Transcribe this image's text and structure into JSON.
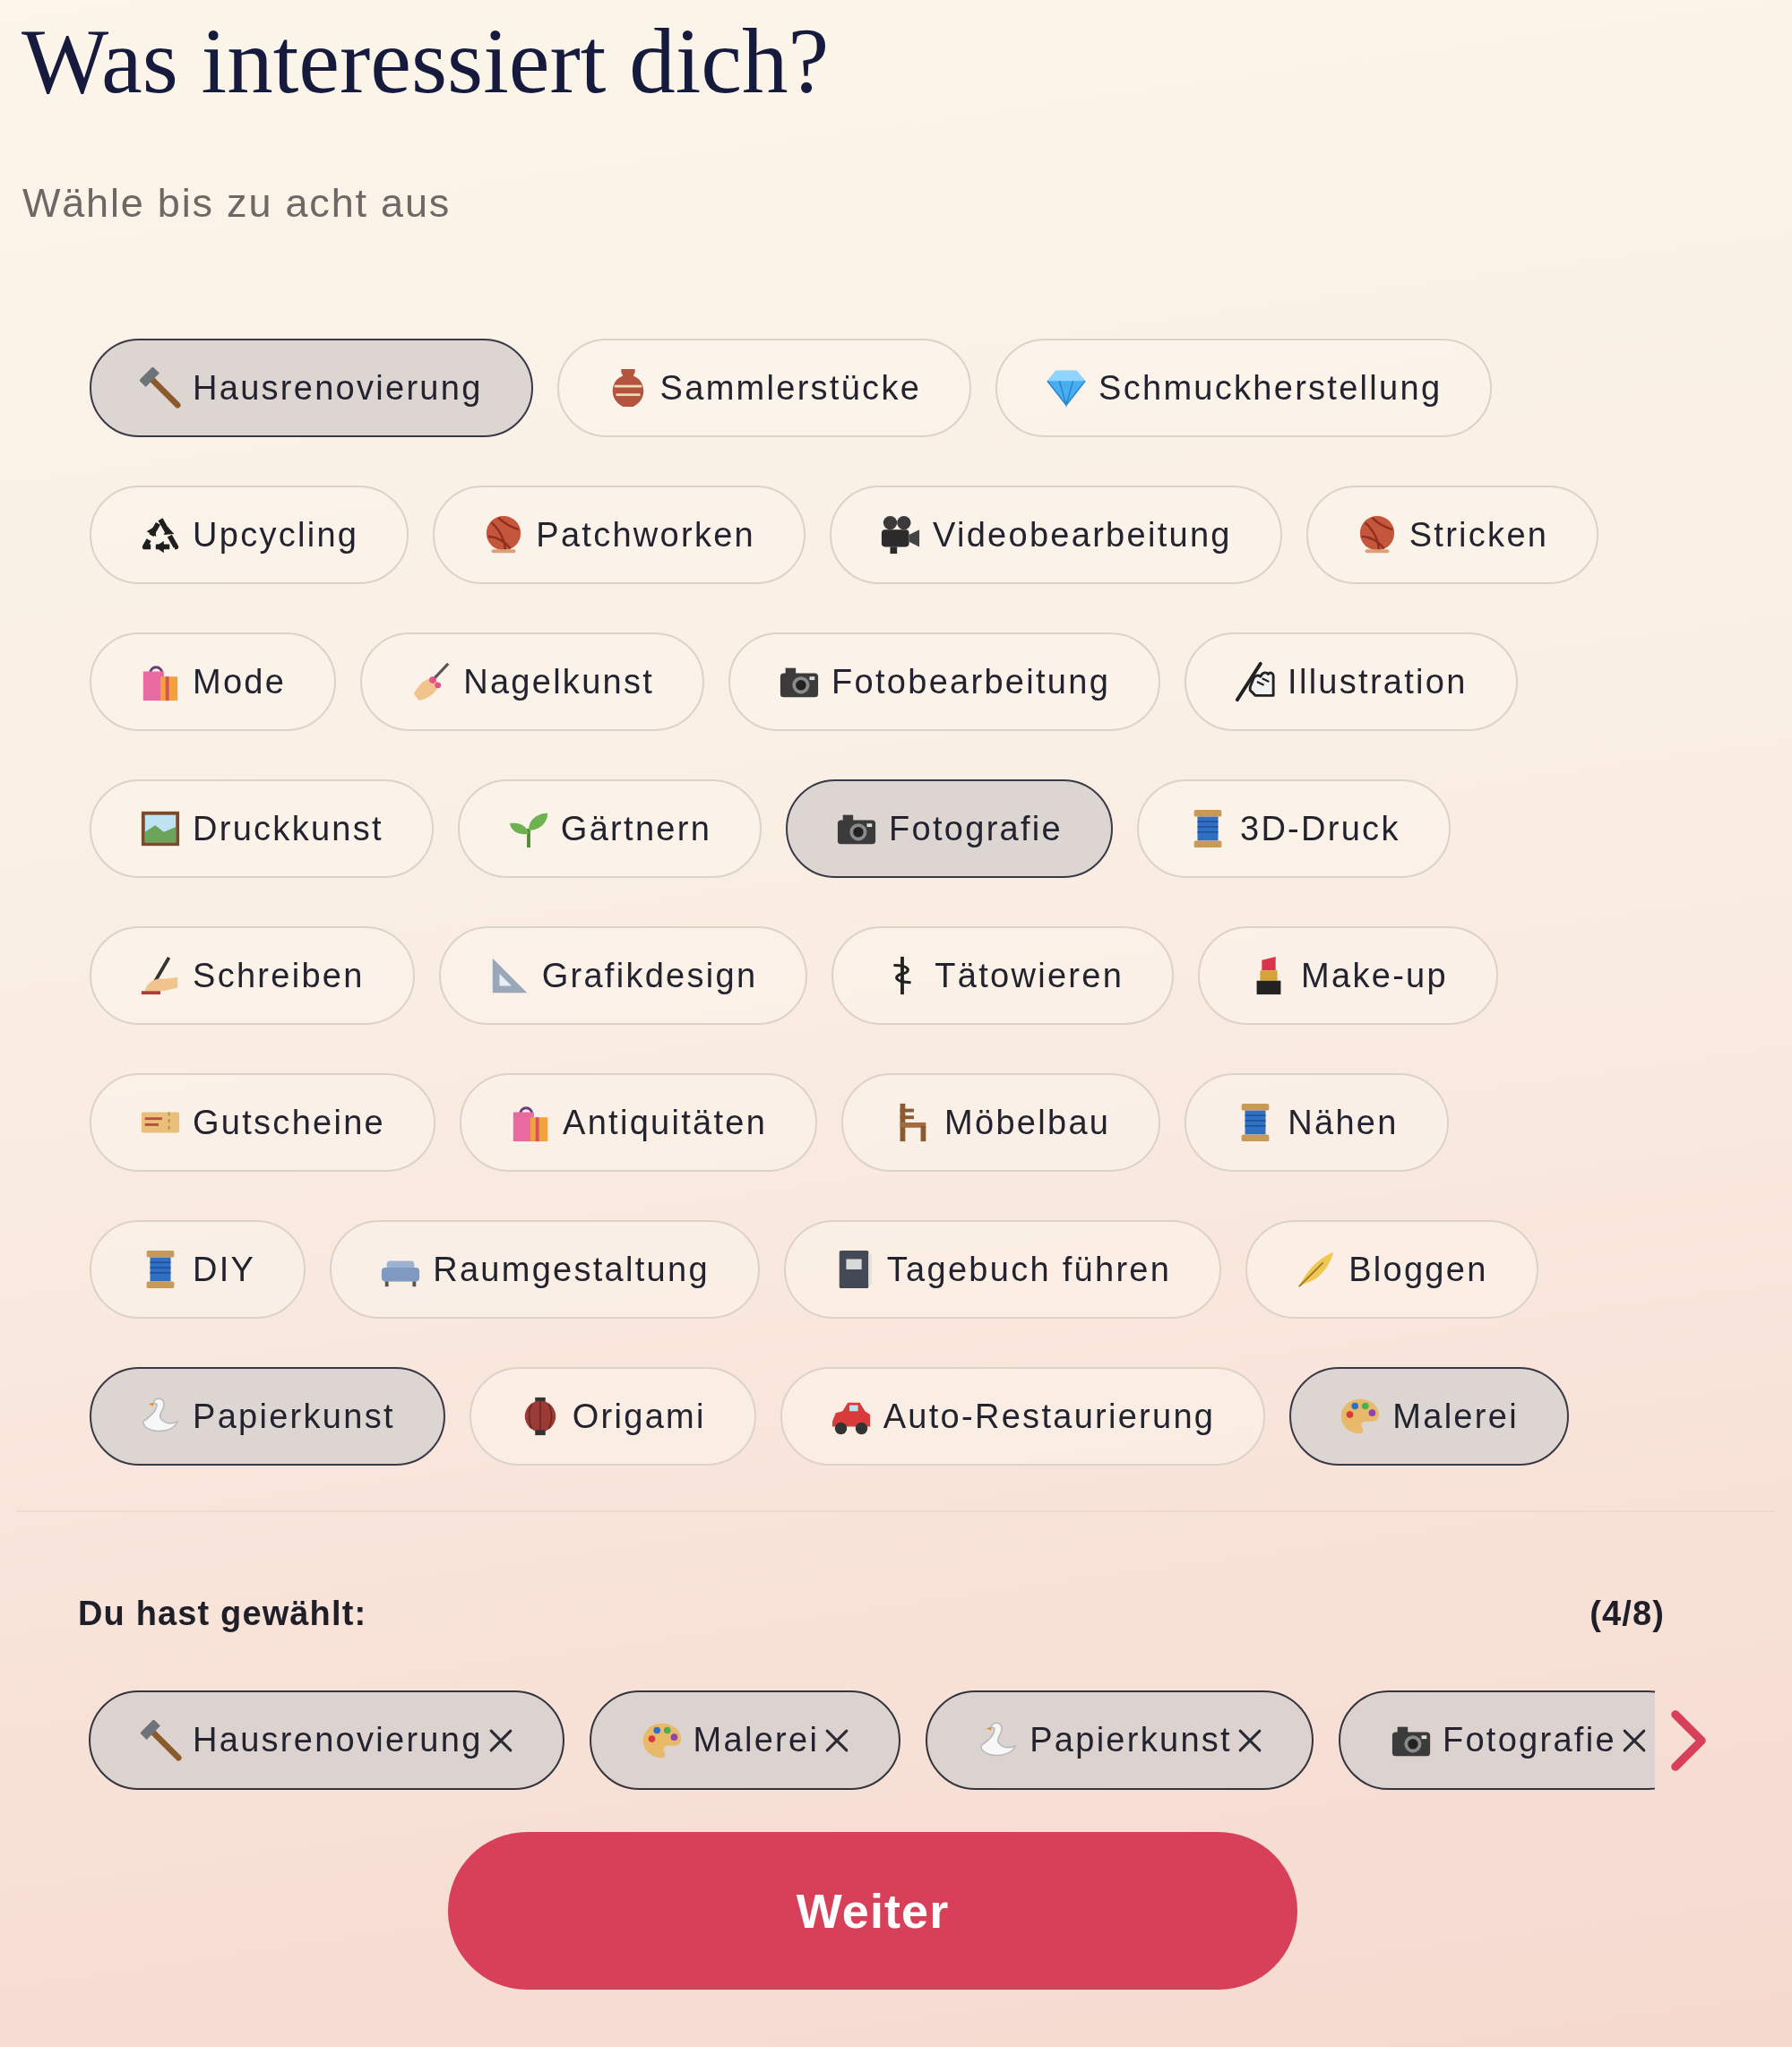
{
  "header": {
    "title": "Was interessiert dich?",
    "subtitle": "Wähle bis zu acht aus"
  },
  "interests": [
    {
      "label": "Hausrenovierung",
      "selected": true
    },
    {
      "label": "Sammlerstücke",
      "selected": false
    },
    {
      "label": "Schmuckherstellung",
      "selected": false
    },
    {
      "label": "Upcycling",
      "selected": false
    },
    {
      "label": "Patchworken",
      "selected": false
    },
    {
      "label": "Videobearbeitung",
      "selected": false
    },
    {
      "label": "Stricken",
      "selected": false
    },
    {
      "label": "Mode",
      "selected": false
    },
    {
      "label": "Nagelkunst",
      "selected": false
    },
    {
      "label": "Fotobearbeitung",
      "selected": false
    },
    {
      "label": "Illustration",
      "selected": false
    },
    {
      "label": "Druckkunst",
      "selected": false
    },
    {
      "label": "Gärtnern",
      "selected": false
    },
    {
      "label": "Fotografie",
      "selected": true
    },
    {
      "label": "3D-Druck",
      "selected": false
    },
    {
      "label": "Schreiben",
      "selected": false
    },
    {
      "label": "Grafikdesign",
      "selected": false
    },
    {
      "label": "Tätowieren",
      "selected": false
    },
    {
      "label": "Make-up",
      "selected": false
    },
    {
      "label": "Gutscheine",
      "selected": false
    },
    {
      "label": "Antiquitäten",
      "selected": false
    },
    {
      "label": "Möbelbau",
      "selected": false
    },
    {
      "label": "Nähen",
      "selected": false
    },
    {
      "label": "DIY",
      "selected": false
    },
    {
      "label": "Raumgestaltung",
      "selected": false
    },
    {
      "label": "Tagebuch führen",
      "selected": false
    },
    {
      "label": "Bloggen",
      "selected": false
    },
    {
      "label": "Papierkunst",
      "selected": true
    },
    {
      "label": "Origami",
      "selected": false
    },
    {
      "label": "Auto-Restaurierung",
      "selected": false
    },
    {
      "label": "Malerei",
      "selected": true
    }
  ],
  "selection": {
    "label": "Du hast gewählt:",
    "count": "(4/8)",
    "chips": [
      "Hausrenovierung",
      "Malerei",
      "Papierkunst",
      "Fotografie"
    ]
  },
  "continue_button": {
    "label": "Weiter"
  }
}
